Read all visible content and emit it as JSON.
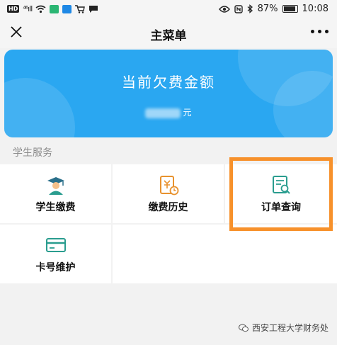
{
  "status_bar": {
    "left_badge": "HD",
    "signal": "⁴⁶ıll",
    "battery_percent": "87%",
    "time": "10:08"
  },
  "nav": {
    "title": "主菜单"
  },
  "banner": {
    "title": "当前欠费金额",
    "amount_unit": "元"
  },
  "section": {
    "label": "学生服务"
  },
  "grid": {
    "items": [
      {
        "label": "学生缴费",
        "icon": "graduate-icon"
      },
      {
        "label": "缴费历史",
        "icon": "receipt-history-icon"
      },
      {
        "label": "订单查询",
        "icon": "order-search-icon"
      },
      {
        "label": "卡号维护",
        "icon": "card-icon"
      }
    ]
  },
  "watermark": {
    "text": "西安工程大学财务处"
  },
  "colors": {
    "banner": "#2aa7f1",
    "highlight": "#f7912b",
    "icon_teal": "#2a9d8f",
    "icon_orange": "#e8922e",
    "icon_blue": "#1e88e5"
  }
}
